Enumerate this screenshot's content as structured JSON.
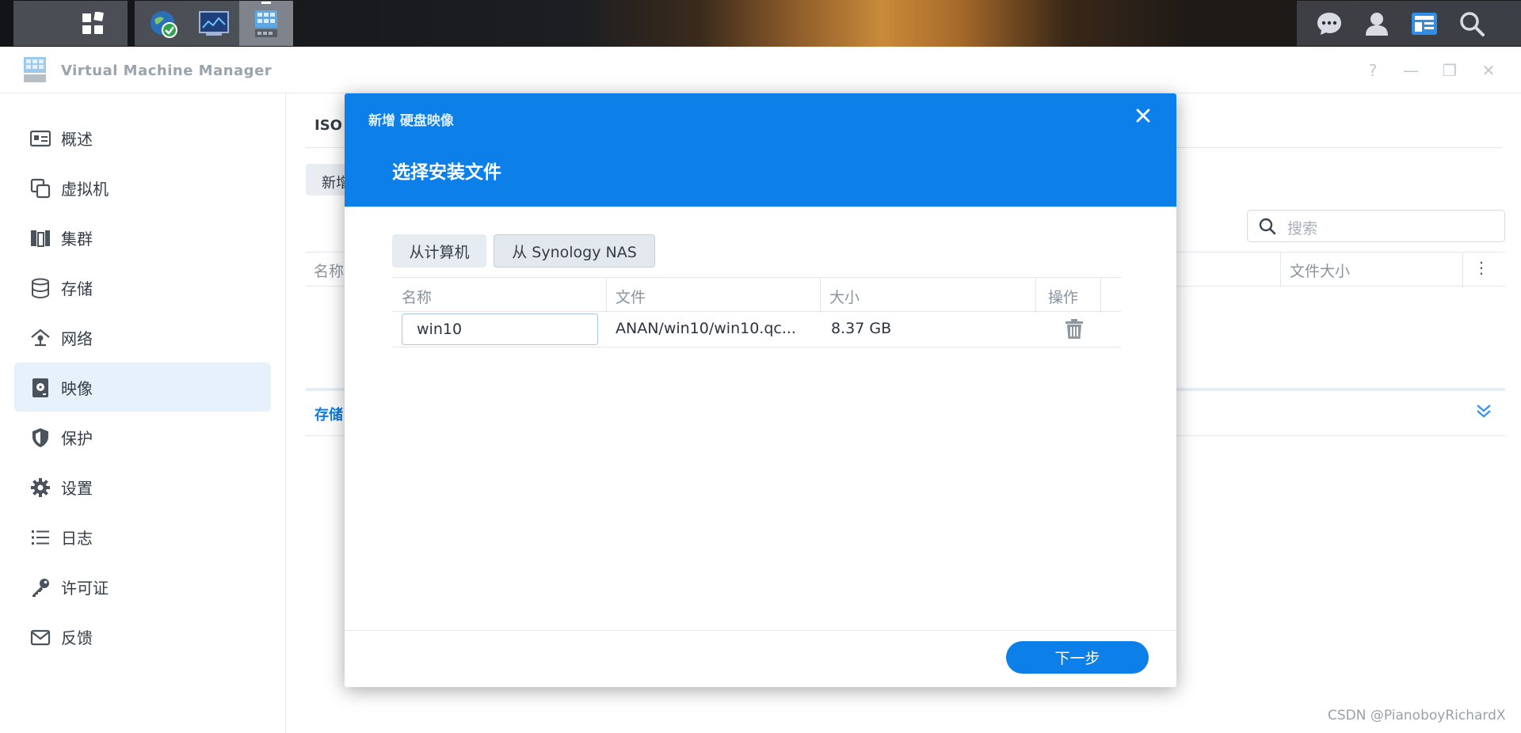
{
  "taskbar": {
    "apps": [
      {
        "name": "main-menu",
        "icon": "grid-icon"
      },
      {
        "name": "security-advisor",
        "icon": "globe-shield-icon"
      },
      {
        "name": "resource-monitor",
        "icon": "monitor-icon"
      },
      {
        "name": "virtual-machine-manager",
        "icon": "vmm-icon"
      }
    ],
    "tray": [
      "chat-icon",
      "user-icon",
      "widget-icon",
      "search-icon"
    ]
  },
  "window": {
    "title": "Virtual Machine Manager",
    "controls": {
      "help": "?",
      "minimize": "—",
      "restore": "❐",
      "close": "✕"
    }
  },
  "sidebar": {
    "items": [
      {
        "label": "概述",
        "icon": "overview-icon"
      },
      {
        "label": "虚拟机",
        "icon": "vm-icon"
      },
      {
        "label": "集群",
        "icon": "cluster-icon"
      },
      {
        "label": "存储",
        "icon": "storage-icon"
      },
      {
        "label": "网络",
        "icon": "network-icon"
      },
      {
        "label": "映像",
        "icon": "image-icon",
        "active": true
      },
      {
        "label": "保护",
        "icon": "shield-icon"
      },
      {
        "label": "设置",
        "icon": "gear-icon"
      },
      {
        "label": "日志",
        "icon": "log-icon"
      },
      {
        "label": "许可证",
        "icon": "key-icon"
      },
      {
        "label": "反馈",
        "icon": "mail-icon"
      }
    ]
  },
  "content": {
    "tab": "ISO",
    "new_button": "新增",
    "search_placeholder": "搜索",
    "col_name": "名称",
    "col_size": "文件大小",
    "lower_tab": "存储"
  },
  "modal": {
    "small_title": "新增 硬盘映像",
    "title": "选择安装文件",
    "sources": [
      {
        "label": "从计算机"
      },
      {
        "label": "从 Synology NAS",
        "selected": true
      }
    ],
    "table": {
      "headers": [
        "名称",
        "文件",
        "大小",
        "操作"
      ],
      "rows": [
        {
          "name": "win10",
          "file": "ANAN/win10/win10.qc...",
          "size": "8.37 GB"
        }
      ]
    },
    "next_button": "下一步"
  },
  "watermark": "CSDN @PianoboyRichardX",
  "colors": {
    "accent": "#0c80e8",
    "active_bg": "#e6f1fc"
  }
}
